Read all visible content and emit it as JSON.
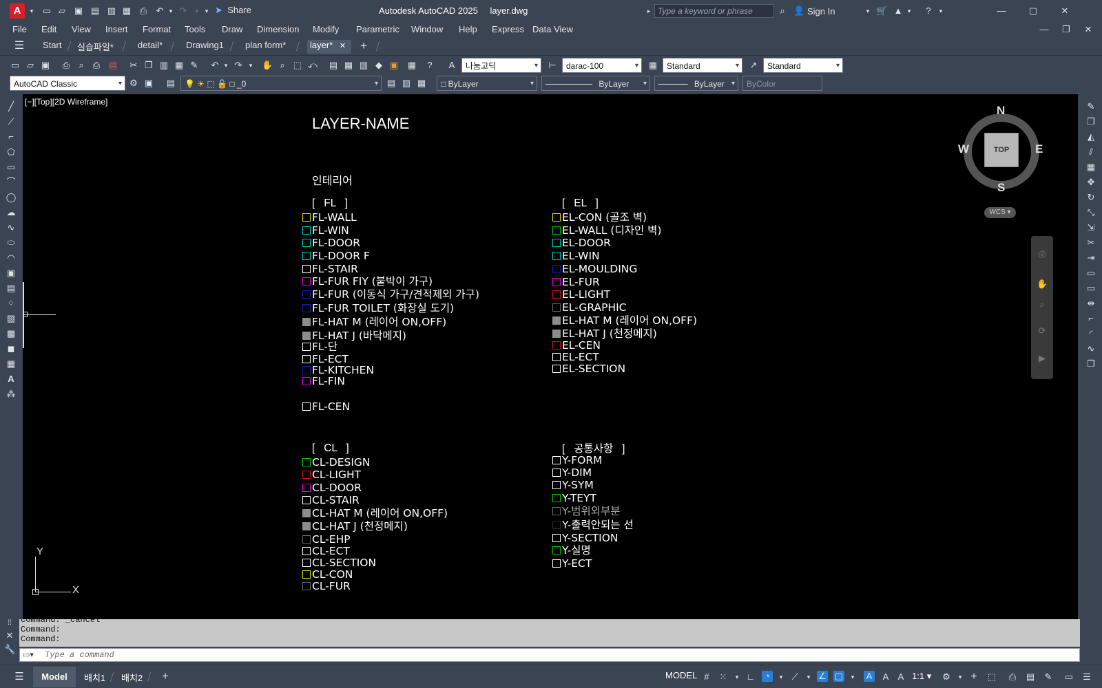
{
  "app": {
    "title": "Autodesk AutoCAD 2025",
    "filename": "layer.dwg",
    "share_label": "Share",
    "search_placeholder": "Type a keyword or phrase",
    "signin_label": "Sign In"
  },
  "menu": [
    "File",
    "Edit",
    "View",
    "Insert",
    "Format",
    "Tools",
    "Draw",
    "Dimension",
    "Modify",
    "Parametric",
    "Window",
    "Help",
    "Express",
    "Data View"
  ],
  "tabs": [
    "Start",
    "실습파일*",
    "detail*",
    "Drawing1",
    "plan form*",
    "layer*"
  ],
  "toolbar": {
    "text_style_font": "나눔고딕",
    "dim_style": "darac-100",
    "table_style": "Standard",
    "mleader_style": "Standard",
    "workspace": "AutoCAD Classic",
    "layer_current": "_0",
    "color": "ByLayer",
    "linetype": "ByLayer",
    "lineweight": "ByLayer",
    "plotstyle": "ByColor"
  },
  "viewport": {
    "label": "[−][Top][2D Wireframe]",
    "compass": {
      "n": "N",
      "s": "S",
      "e": "E",
      "w": "W",
      "top": "TOP"
    },
    "wcs": "WCS",
    "ucs": {
      "x": "X",
      "y": "Y"
    }
  },
  "drawing": {
    "title": "LAYER-NAME",
    "subtitle": "인테리어",
    "groups": {
      "fl": {
        "header": "[   FL   ]",
        "items": [
          {
            "name": "FL-WALL",
            "color": "#e6e600",
            "filled": false
          },
          {
            "name": "FL-WIN",
            "color": "#00c8c8",
            "filled": false
          },
          {
            "name": "FL-DOOR",
            "color": "#00c8c8",
            "filled": false
          },
          {
            "name": "FL-DOOR F",
            "color": "#00c8c8",
            "filled": false
          },
          {
            "name": "FL-STAIR",
            "color": "#ffffff",
            "filled": false
          },
          {
            "name": "FL-FUR FIY (붙박이 가구)",
            "color": "#e000e0",
            "filled": false
          },
          {
            "name": "FL-FUR (이동식 가구/견적제외 가구)",
            "color": "#1a1ab4",
            "filled": false
          },
          {
            "name": "FL-FUR TOILET (화장실 도기)",
            "color": "#1a1ab4",
            "filled": false
          },
          {
            "name": "FL-HAT M (레이어 ON,OFF)",
            "color": "#8c8c8c",
            "filled": true
          },
          {
            "name": "FL-HAT J (바닥메지)",
            "color": "#8c8c8c",
            "filled": true
          },
          {
            "name": "FL-단",
            "color": "#ffffff",
            "filled": false
          },
          {
            "name": "FL-ECT",
            "color": "#ffffff",
            "filled": false
          },
          {
            "name": "FL-KITCHEN",
            "color": "#1a1ab4",
            "filled": false
          },
          {
            "name": "FL-FIN",
            "color": "#e000e0",
            "filled": false
          },
          {
            "name": "FL-CEN",
            "color": "#ffffff",
            "filled": false
          }
        ]
      },
      "el": {
        "header": "[   EL   ]",
        "items": [
          {
            "name": "EL-CON (골조 벽)",
            "color": "#e6e600",
            "filled": false
          },
          {
            "name": "EL-WALL (디자인 벽)",
            "color": "#00c800",
            "filled": false
          },
          {
            "name": "EL-DOOR",
            "color": "#00c8c8",
            "filled": false
          },
          {
            "name": "EL-WIN",
            "color": "#00c8c8",
            "filled": false
          },
          {
            "name": "EL-MOULDING",
            "color": "#1a1ab4",
            "filled": false
          },
          {
            "name": "EL-FUR",
            "color": "#e000e0",
            "filled": false
          },
          {
            "name": "EL-LIGHT",
            "color": "#d01010",
            "filled": false
          },
          {
            "name": "EL-GRAPHIC",
            "color": "#6a6a6a",
            "filled": false
          },
          {
            "name": "EL-HAT M (레이어 ON,OFF)",
            "color": "#8c8c8c",
            "filled": true
          },
          {
            "name": "EL-HAT J (천정메지)",
            "color": "#8c8c8c",
            "filled": true
          },
          {
            "name": "EL-CEN",
            "color": "#d01010",
            "filled": false
          },
          {
            "name": "EL-ECT",
            "color": "#ffffff",
            "filled": false
          },
          {
            "name": "EL-SECTION",
            "color": "#ffffff",
            "filled": false
          }
        ]
      },
      "cl": {
        "header": "[   CL   ]",
        "items": [
          {
            "name": "CL-DESIGN",
            "color": "#00c800",
            "filled": false
          },
          {
            "name": "CL-LIGHT",
            "color": "#d01010",
            "filled": false
          },
          {
            "name": "CL-DOOR",
            "color": "#e000e0",
            "filled": false
          },
          {
            "name": "CL-STAIR",
            "color": "#ffffff",
            "filled": false
          },
          {
            "name": "CL-HAT M (레이어 ON,OFF)",
            "color": "#8c8c8c",
            "filled": true
          },
          {
            "name": "CL-HAT J (천정메지)",
            "color": "#8c8c8c",
            "filled": true
          },
          {
            "name": "CL-EHP",
            "color": "#6a6a6a",
            "filled": false
          },
          {
            "name": "CL-ECT",
            "color": "#ffffff",
            "filled": false
          },
          {
            "name": "CL-SECTION",
            "color": "#ffffff",
            "filled": false
          },
          {
            "name": "CL-CON",
            "color": "#e6e600",
            "filled": false
          },
          {
            "name": "CL-FUR",
            "color": "#6a6a6a",
            "filled": false
          }
        ]
      },
      "common": {
        "header": "[   공통사항   ]",
        "items": [
          {
            "name": "Y-FORM",
            "color": "#ffffff",
            "filled": false
          },
          {
            "name": "Y-DIM",
            "color": "#ffffff",
            "filled": false
          },
          {
            "name": "Y-SYM",
            "color": "#ffffff",
            "filled": false
          },
          {
            "name": "Y-TEYT",
            "color": "#00c800",
            "filled": false
          },
          {
            "name": "Y-범위외부분",
            "color": "#6a6a6a",
            "filled": false,
            "dim": true
          },
          {
            "name": "Y-출력안되는 선",
            "color": "#2a2a2a",
            "filled": false
          },
          {
            "name": "Y-SECTION",
            "color": "#ffffff",
            "filled": false
          },
          {
            "name": "Y-실명",
            "color": "#00c800",
            "filled": false
          },
          {
            "name": "Y-ECT",
            "color": "#ffffff",
            "filled": false
          }
        ]
      }
    }
  },
  "command": {
    "history": [
      "Command: _cancel",
      "Command:",
      "Command:"
    ],
    "placeholder": "Type a command"
  },
  "status": {
    "layout_tabs": [
      "Model",
      "배치1",
      "배치2"
    ],
    "model_label": "MODEL",
    "scale": "1:1"
  }
}
